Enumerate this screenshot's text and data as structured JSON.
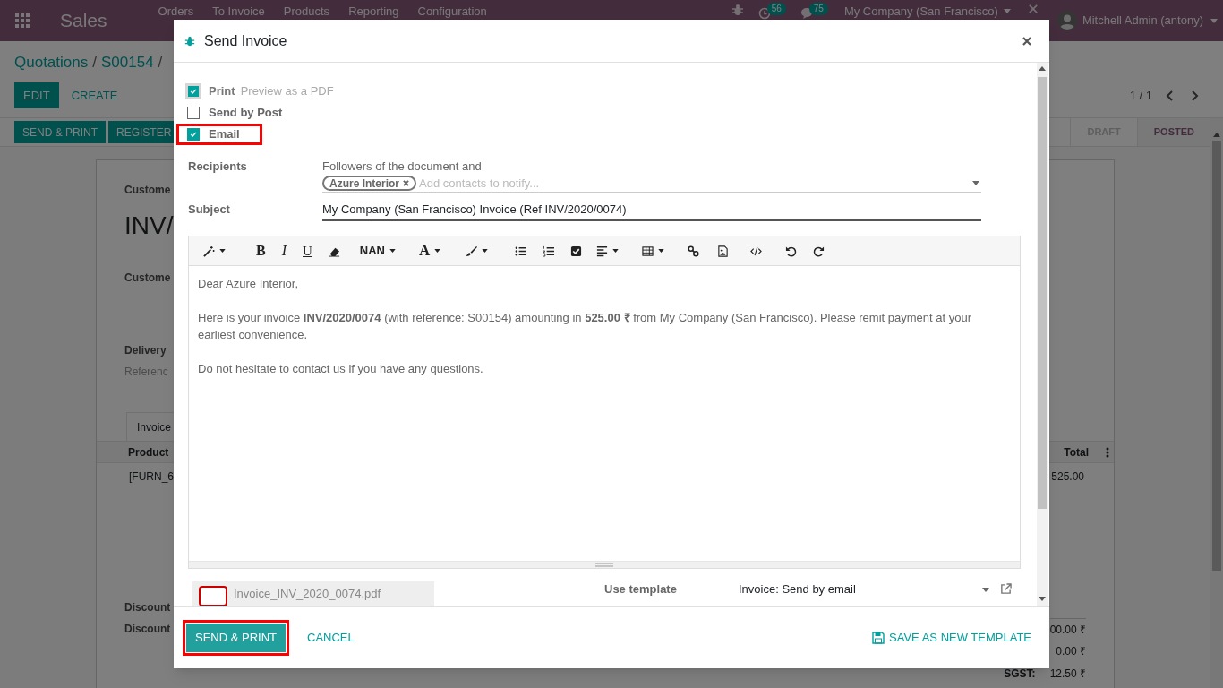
{
  "navbar": {
    "app_title": "Sales",
    "menu": [
      "Orders",
      "To Invoice",
      "Products",
      "Reporting",
      "Configuration"
    ],
    "activity_count": "56",
    "message_count": "75",
    "company": "My Company (San Francisco)",
    "user": "Mitchell Admin (antony)"
  },
  "breadcrumb": {
    "items": [
      "Quotations",
      "S00154"
    ],
    "separator": "/"
  },
  "control_buttons": [
    {
      "label": "EDIT",
      "kind": "primary"
    },
    {
      "label": "CREATE",
      "kind": "link"
    }
  ],
  "pager": "1 / 1",
  "action_buttons": [
    "SEND & PRINT",
    "REGISTER"
  ],
  "statuses": [
    {
      "label": "DRAFT",
      "selected": false
    },
    {
      "label": "POSTED",
      "selected": true
    }
  ],
  "sheet": {
    "customer_label": "Custome",
    "document_number": "INV/",
    "customer_address_label": "Custome",
    "delivery_label": "Delivery",
    "reference_label": "Referenc",
    "tab": "Invoice",
    "columns": [
      "Product",
      "Total"
    ],
    "rows": [
      [
        "[FURN_6",
        "525.00"
      ]
    ],
    "discount_labels": [
      "Discount",
      "Discount"
    ],
    "totals": [
      {
        "value": "00.00 ₹"
      },
      {
        "value": "0.00 ₹"
      },
      {
        "label": "SGST:",
        "value": "12.50 ₹"
      }
    ]
  },
  "dialog": {
    "title": "Send Invoice",
    "options": [
      {
        "label": "Print",
        "hint": "Preview as a PDF",
        "checked": true,
        "disabled": true,
        "highlighted": false
      },
      {
        "label": "Send by Post",
        "checked": false,
        "disabled": false,
        "highlighted": false
      },
      {
        "label": "Email",
        "checked": true,
        "disabled": false,
        "highlighted": true
      }
    ],
    "recipients": {
      "label": "Recipients",
      "note": "Followers of the document and",
      "tags": [
        "Azure Interior"
      ],
      "placeholder": "Add contacts to notify..."
    },
    "subject": {
      "label": "Subject",
      "value": "My Company (San Francisco) Invoice (Ref INV/2020/0074)"
    },
    "toolbar": [
      {
        "kind": "wand",
        "caret": true
      },
      {
        "kind": "bold",
        "label": "B",
        "caret": false
      },
      {
        "kind": "italic",
        "label": "I",
        "caret": false
      },
      {
        "kind": "underline",
        "label": "U",
        "caret": false
      },
      {
        "kind": "eraser",
        "caret": false
      },
      {
        "kind": "size",
        "label": "NAN",
        "caret": true
      },
      {
        "kind": "color",
        "label": "A",
        "caret": true
      },
      {
        "kind": "brush",
        "caret": true
      },
      {
        "kind": "bullets",
        "caret": false
      },
      {
        "kind": "numbers",
        "caret": false
      },
      {
        "kind": "checklist",
        "caret": false
      },
      {
        "kind": "align",
        "caret": true
      },
      {
        "kind": "table",
        "caret": true
      },
      {
        "kind": "link",
        "caret": false
      },
      {
        "kind": "image",
        "caret": false
      },
      {
        "kind": "code",
        "caret": false
      },
      {
        "kind": "undo",
        "caret": false
      },
      {
        "kind": "redo",
        "caret": false
      }
    ],
    "body": [
      "Dear Azure Interior,",
      "Here is your invoice **INV/2020/0074** (with reference: S00154) amounting in **525.00 ₹** from My Company (San Francisco). Please remit payment at your earliest convenience.",
      "Do not hesitate to contact us if you have any questions."
    ],
    "attachment": "Invoice_INV_2020_0074.pdf",
    "template": {
      "label": "Use template",
      "value": "Invoice: Send by email"
    },
    "buttons": [
      {
        "label": "SEND & PRINT",
        "kind": "primary",
        "highlighted": true
      },
      {
        "label": "CANCEL",
        "kind": "link",
        "highlighted": false
      },
      {
        "label": "SAVE AS NEW TEMPLATE",
        "kind": "save",
        "highlighted": false
      }
    ]
  }
}
